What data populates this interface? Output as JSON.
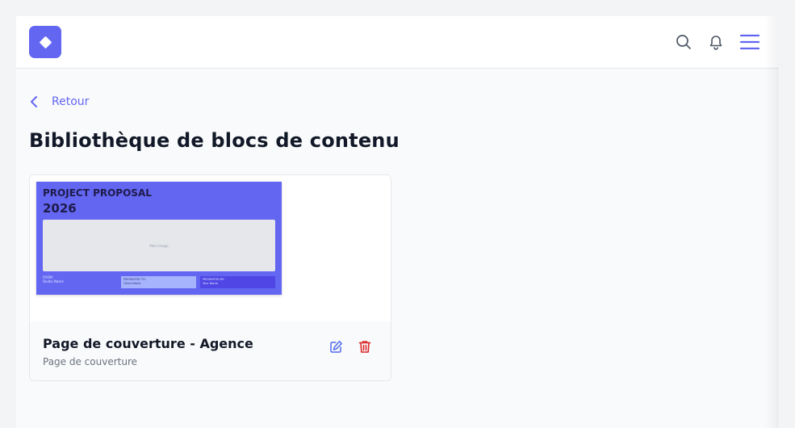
{
  "header": {
    "logo_icon": "diamond-icon",
    "search_icon": "search-icon",
    "notifications_icon": "bell-icon",
    "menu_icon": "menu-icon",
    "brand_color": "#6366f1"
  },
  "nav": {
    "back_label": "Retour",
    "back_icon": "chevron-left-icon"
  },
  "page": {
    "title": "Bibliothèque de blocs de contenu"
  },
  "blocks": [
    {
      "title": "Page de couverture - Agence",
      "type": "Page de couverture",
      "preview": {
        "heading": "PROJECT PROPOSAL",
        "year": "2026",
        "image_placeholder": "Main Image",
        "from_label": "FROM:",
        "from_value": "Studio Name",
        "to_label": "PRESENTED TO:",
        "to_value": "Client Name",
        "by_label": "PRESENTED BY:",
        "by_value": "Your Name",
        "background_color": "#6366f1"
      },
      "actions": {
        "edit_icon": "edit-icon",
        "delete_icon": "trash-icon",
        "edit_color": "#4f6bed",
        "delete_color": "#dc2626"
      }
    }
  ]
}
